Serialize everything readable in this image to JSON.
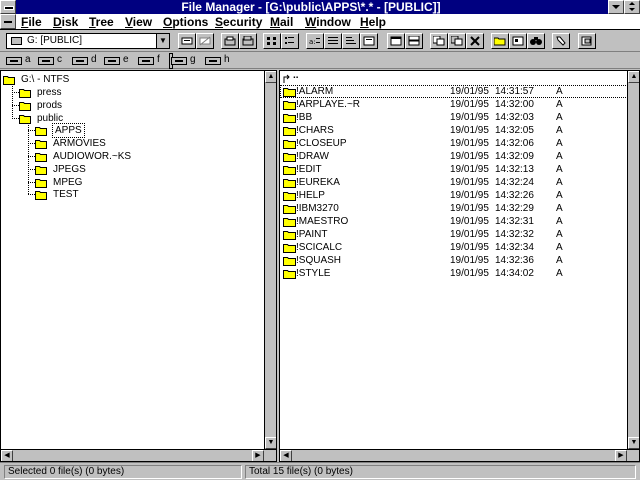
{
  "window": {
    "title": "File Manager - [G:\\public\\APPS\\*.* - [PUBLIC]]"
  },
  "menu": [
    {
      "key": "F",
      "rest": "ile"
    },
    {
      "key": "D",
      "rest": "isk"
    },
    {
      "key": "T",
      "rest": "ree"
    },
    {
      "key": "V",
      "rest": "iew"
    },
    {
      "key": "O",
      "rest": "ptions"
    },
    {
      "key": "S",
      "rest": "ecurity"
    },
    {
      "key": "M",
      "rest": "ail"
    },
    {
      "key": "W",
      "rest": "indow"
    },
    {
      "key": "H",
      "rest": "elp"
    }
  ],
  "toolbar": {
    "drive_selector": "G: [PUBLIC]"
  },
  "drives": [
    "a",
    "c",
    "d",
    "e",
    "f",
    "g",
    "h"
  ],
  "selected_drive": "g",
  "tree": {
    "root": "G:\\ - NTFS",
    "items": [
      "press",
      "prods",
      "public",
      "APPS",
      "ARMOVIES",
      "AUDIOWOR.~KS",
      "JPEGS",
      "MPEG",
      "TEST"
    ]
  },
  "files": {
    "parent_label": "..",
    "rows": [
      {
        "name": "!ALARM",
        "date": "19/01/95",
        "time": "14:31:57",
        "attr": "A"
      },
      {
        "name": "!ARPLAYE.~R",
        "date": "19/01/95",
        "time": "14:32:00",
        "attr": "A"
      },
      {
        "name": "!BB",
        "date": "19/01/95",
        "time": "14:32:03",
        "attr": "A"
      },
      {
        "name": "!CHARS",
        "date": "19/01/95",
        "time": "14:32:05",
        "attr": "A"
      },
      {
        "name": "!CLOSEUP",
        "date": "19/01/95",
        "time": "14:32:06",
        "attr": "A"
      },
      {
        "name": "!DRAW",
        "date": "19/01/95",
        "time": "14:32:09",
        "attr": "A"
      },
      {
        "name": "!EDIT",
        "date": "19/01/95",
        "time": "14:32:13",
        "attr": "A"
      },
      {
        "name": "!EUREKA",
        "date": "19/01/95",
        "time": "14:32:24",
        "attr": "A"
      },
      {
        "name": "!HELP",
        "date": "19/01/95",
        "time": "14:32:26",
        "attr": "A"
      },
      {
        "name": "!IBM3270",
        "date": "19/01/95",
        "time": "14:32:29",
        "attr": "A"
      },
      {
        "name": "!MAESTRO",
        "date": "19/01/95",
        "time": "14:32:31",
        "attr": "A"
      },
      {
        "name": "!PAINT",
        "date": "19/01/95",
        "time": "14:32:32",
        "attr": "A"
      },
      {
        "name": "!SCICALC",
        "date": "19/01/95",
        "time": "14:32:34",
        "attr": "A"
      },
      {
        "name": "!SQUASH",
        "date": "19/01/95",
        "time": "14:32:36",
        "attr": "A"
      },
      {
        "name": "!STYLE",
        "date": "19/01/95",
        "time": "14:34:02",
        "attr": "A"
      }
    ]
  },
  "status": {
    "left": "Selected 0 file(s) (0 bytes)",
    "right": "Total 15 file(s) (0 bytes)"
  },
  "colors": {
    "titlebar": "#000080",
    "face": "#c0c0c0",
    "folder": "#ffff00"
  }
}
